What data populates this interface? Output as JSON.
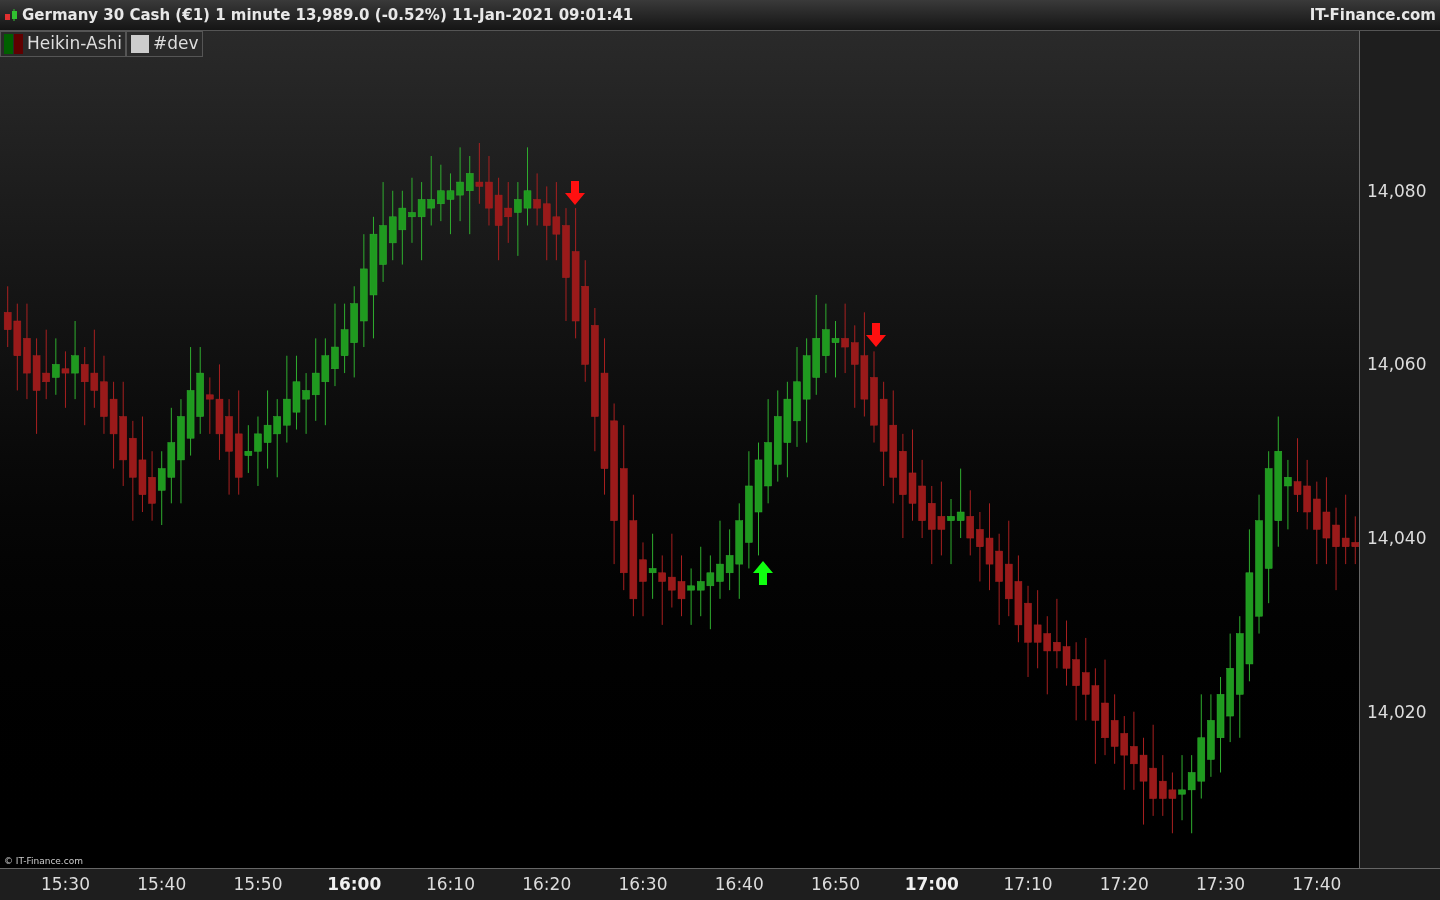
{
  "title_bar": {
    "title": "Germany 30 Cash (€1) 1 minute 13,989.0 (-0.52%) 11-Jan-2021 09:01:41",
    "brand": "IT-Finance.com"
  },
  "legend": [
    {
      "label": "Heikin-Ashi",
      "kind": "candles"
    },
    {
      "label": "#dev",
      "kind": "plain"
    }
  ],
  "chart_data": {
    "type": "candlestick",
    "ylim": [
      14002,
      14098.4
    ],
    "x": [
      924,
      925,
      926,
      927,
      928,
      929,
      930,
      931,
      932,
      933,
      934,
      935,
      936,
      937,
      938,
      939,
      940,
      941,
      942,
      943,
      944,
      945,
      946,
      947,
      948,
      949,
      950,
      951,
      952,
      953,
      954,
      955,
      956,
      957,
      958,
      959,
      960,
      961,
      962,
      963,
      964,
      965,
      966,
      967,
      968,
      969,
      970,
      971,
      972,
      973,
      974,
      975,
      976,
      977,
      978,
      979,
      980,
      981,
      982,
      983,
      984,
      985,
      986,
      987,
      988,
      989,
      990,
      991,
      992,
      993,
      994,
      995,
      996,
      997,
      998,
      999,
      1000,
      1001,
      1002,
      1003,
      1004,
      1005,
      1006,
      1007,
      1008,
      1009,
      1010,
      1011,
      1012,
      1013,
      1014,
      1015,
      1016,
      1017,
      1018,
      1019,
      1020,
      1021,
      1022,
      1023,
      1024,
      1025,
      1026,
      1027,
      1028,
      1029,
      1030,
      1031,
      1032,
      1033,
      1034,
      1035,
      1036,
      1037,
      1038,
      1039,
      1040,
      1041,
      1042,
      1043,
      1044,
      1045,
      1046,
      1047,
      1048,
      1049,
      1050,
      1051,
      1052,
      1053,
      1054,
      1055,
      1056,
      1057,
      1058,
      1059,
      1060,
      1061,
      1062,
      1063,
      1064
    ],
    "xlim": [
      923.2,
      1072.8
    ],
    "yticks": [
      {
        "value": 14080,
        "label": "14,080"
      },
      {
        "value": 14060,
        "label": "14,060"
      },
      {
        "value": 14040,
        "label": "14,040"
      },
      {
        "value": 14020,
        "label": "14,020"
      }
    ],
    "xticks": [
      {
        "value": 930,
        "label": "15:30"
      },
      {
        "value": 940,
        "label": "15:40"
      },
      {
        "value": 950,
        "label": "15:50"
      },
      {
        "value": 960,
        "label": "16:00"
      },
      {
        "value": 970,
        "label": "16:10"
      },
      {
        "value": 980,
        "label": "16:20"
      },
      {
        "value": 990,
        "label": "16:30"
      },
      {
        "value": 1000,
        "label": "16:40"
      },
      {
        "value": 1010,
        "label": "16:50"
      },
      {
        "value": 1020,
        "label": "17:00"
      },
      {
        "value": 1030,
        "label": "17:10"
      },
      {
        "value": 1040,
        "label": "17:20"
      },
      {
        "value": 1050,
        "label": "17:30"
      },
      {
        "value": 1060,
        "label": "17:40"
      }
    ],
    "ohlc": [
      [
        14066,
        14069,
        14062,
        14064
      ],
      [
        14065,
        14067,
        14057,
        14061
      ],
      [
        14063,
        14067,
        14056,
        14059
      ],
      [
        14061,
        14063,
        14052,
        14057
      ],
      [
        14059,
        14064,
        14056,
        14058
      ],
      [
        14058.5,
        14063,
        14056.5,
        14060
      ],
      [
        14059.5,
        14061.5,
        14055,
        14059
      ],
      [
        14059,
        14065,
        14056,
        14061
      ],
      [
        14060,
        14062,
        14053,
        14058
      ],
      [
        14059,
        14064,
        14055,
        14057
      ],
      [
        14058,
        14061,
        14052,
        14054
      ],
      [
        14056,
        14058,
        14048,
        14052
      ],
      [
        14054,
        14058,
        14046,
        14049
      ],
      [
        14051.5,
        14053.5,
        14042,
        14047
      ],
      [
        14049,
        14054,
        14043,
        14045
      ],
      [
        14047,
        14050,
        14042,
        14044
      ],
      [
        14045.5,
        14050,
        14041.5,
        14048
      ],
      [
        14047,
        14055,
        14044,
        14051
      ],
      [
        14049,
        14056,
        14044,
        14054
      ],
      [
        14051.5,
        14062,
        14049.5,
        14057
      ],
      [
        14054,
        14062,
        14052,
        14059
      ],
      [
        14056.5,
        14058.5,
        14052,
        14056
      ],
      [
        14056,
        14060,
        14049,
        14052
      ],
      [
        14054,
        14056,
        14045,
        14050
      ],
      [
        14052,
        14057,
        14045,
        14047
      ],
      [
        14049.5,
        14053,
        14047.5,
        14050
      ],
      [
        14050,
        14054,
        14046,
        14052
      ],
      [
        14051,
        14057,
        14048,
        14053
      ],
      [
        14052,
        14056,
        14047,
        14054
      ],
      [
        14053,
        14061,
        14051,
        14056
      ],
      [
        14054.5,
        14061,
        14052.5,
        14058
      ],
      [
        14056,
        14059,
        14052,
        14057
      ],
      [
        14056.5,
        14063,
        14053.5,
        14059
      ],
      [
        14058,
        14063,
        14053,
        14061
      ],
      [
        14059.5,
        14067,
        14057.5,
        14062
      ],
      [
        14061,
        14067,
        14059,
        14064
      ],
      [
        14062.5,
        14069,
        14058.5,
        14067
      ],
      [
        14065,
        14075,
        14062,
        14071
      ],
      [
        14068,
        14077,
        14063,
        14075
      ],
      [
        14071.5,
        14081,
        14069.5,
        14076
      ],
      [
        14074,
        14080,
        14072,
        14077
      ],
      [
        14075.5,
        14080,
        14071.5,
        14078
      ],
      [
        14077,
        14081.5,
        14074,
        14077.5
      ],
      [
        14077,
        14081,
        14072,
        14079
      ],
      [
        14078,
        14084,
        14076,
        14079
      ],
      [
        14078.5,
        14083,
        14076.5,
        14080
      ],
      [
        14079,
        14082,
        14075,
        14080
      ],
      [
        14079.5,
        14085,
        14076.5,
        14081
      ],
      [
        14080,
        14084,
        14075,
        14082
      ],
      [
        14081,
        14085.5,
        14078.5,
        14080.5
      ],
      [
        14081,
        14084,
        14076,
        14078
      ],
      [
        14079.5,
        14081.5,
        14072,
        14076
      ],
      [
        14078,
        14081,
        14074,
        14077
      ],
      [
        14077.5,
        14081,
        14072.5,
        14079
      ],
      [
        14078,
        14085,
        14076,
        14080
      ],
      [
        14079,
        14082,
        14076,
        14078
      ],
      [
        14078.5,
        14080.5,
        14072,
        14076
      ],
      [
        14077,
        14081,
        14072,
        14075
      ],
      [
        14076,
        14078,
        14065,
        14070
      ],
      [
        14073,
        14078,
        14063,
        14065
      ],
      [
        14069,
        14072,
        14058,
        14060
      ],
      [
        14064.5,
        14066.5,
        14050,
        14054
      ],
      [
        14059,
        14063,
        14045,
        14048
      ],
      [
        14053.5,
        14055.5,
        14037,
        14042
      ],
      [
        14048,
        14053,
        14034,
        14036
      ],
      [
        14042,
        14045,
        14031,
        14033
      ],
      [
        14037.5,
        14039.5,
        14031,
        14035
      ],
      [
        14036,
        14040.5,
        14033,
        14036.5
      ],
      [
        14036,
        14038,
        14030,
        14035
      ],
      [
        14035.5,
        14040.5,
        14032,
        14034
      ],
      [
        14035,
        14038,
        14031,
        14033
      ],
      [
        14034,
        14036.5,
        14030,
        14034.5
      ],
      [
        14034,
        14039,
        14031,
        14035
      ],
      [
        14034.5,
        14038,
        14029.5,
        14036
      ],
      [
        14035,
        14042,
        14033,
        14037
      ],
      [
        14036,
        14041,
        14034,
        14038
      ],
      [
        14037,
        14044,
        14033,
        14042
      ],
      [
        14039.5,
        14050,
        14036.5,
        14046
      ],
      [
        14043,
        14051,
        14038,
        14049
      ],
      [
        14046,
        14056,
        14044,
        14051
      ],
      [
        14048.5,
        14057,
        14046.5,
        14054
      ],
      [
        14051,
        14058,
        14047,
        14056
      ],
      [
        14053.5,
        14062,
        14050.5,
        14058
      ],
      [
        14056,
        14063,
        14051,
        14061
      ],
      [
        14058.5,
        14068,
        14056.5,
        14063
      ],
      [
        14061,
        14067,
        14059,
        14064
      ],
      [
        14062.5,
        14065,
        14058.5,
        14063
      ],
      [
        14063,
        14067,
        14059,
        14062
      ],
      [
        14062.5,
        14064.5,
        14055,
        14060
      ],
      [
        14061,
        14066,
        14054,
        14056
      ],
      [
        14058.5,
        14061.5,
        14051,
        14053
      ],
      [
        14056,
        14058,
        14046,
        14050
      ],
      [
        14053,
        14057,
        14044,
        14047
      ],
      [
        14050,
        14052,
        14040,
        14045
      ],
      [
        14047.5,
        14052.5,
        14042,
        14044
      ],
      [
        14046,
        14049,
        14040,
        14042
      ],
      [
        14044,
        14046,
        14037,
        14041
      ],
      [
        14042.5,
        14046.5,
        14038,
        14041
      ],
      [
        14042,
        14044.5,
        14037,
        14042.5
      ],
      [
        14042,
        14048,
        14040,
        14043
      ],
      [
        14042.5,
        14045.5,
        14038,
        14040
      ],
      [
        14041,
        14043,
        14035,
        14039
      ],
      [
        14040,
        14044,
        14034,
        14037
      ],
      [
        14038.5,
        14040.5,
        14030,
        14035
      ],
      [
        14037,
        14042,
        14031,
        14033
      ],
      [
        14035,
        14038,
        14028,
        14030
      ],
      [
        14032.5,
        14034.5,
        14024,
        14028
      ],
      [
        14030,
        14034,
        14025,
        14028
      ],
      [
        14029,
        14031,
        14022,
        14027
      ],
      [
        14028,
        14033,
        14025,
        14027
      ],
      [
        14027.5,
        14030.5,
        14023,
        14025
      ],
      [
        14026,
        14028,
        14019,
        14023
      ],
      [
        14024.5,
        14028.5,
        14019,
        14022
      ],
      [
        14023,
        14025,
        14014,
        14019
      ],
      [
        14021,
        14026,
        14015,
        14017
      ],
      [
        14019,
        14022,
        14014,
        14016
      ],
      [
        14017.5,
        14019.5,
        14011,
        14015
      ],
      [
        14016,
        14020,
        14011,
        14014
      ],
      [
        14015,
        14017,
        14007,
        14012
      ],
      [
        14013.5,
        14018.5,
        14008,
        14010
      ],
      [
        14012,
        14015,
        14008,
        14010
      ],
      [
        14011,
        14013,
        14006,
        14010
      ],
      [
        14010.5,
        14015,
        14007.5,
        14011
      ],
      [
        14011,
        14015,
        14006,
        14013
      ],
      [
        14012,
        14022,
        14010,
        14017
      ],
      [
        14014.5,
        14022,
        14012.5,
        14019
      ],
      [
        14017,
        14024,
        14013,
        14022
      ],
      [
        14019.5,
        14029,
        14016.5,
        14025
      ],
      [
        14022,
        14031,
        14017,
        14029
      ],
      [
        14025.5,
        14041,
        14023.5,
        14036
      ],
      [
        14031,
        14045,
        14029,
        14042
      ],
      [
        14036.5,
        14050,
        14032.5,
        14048
      ],
      [
        14042,
        14054,
        14039,
        14050
      ],
      [
        14046,
        14049,
        14041,
        14047
      ],
      [
        14046.5,
        14051.5,
        14043,
        14045
      ],
      [
        14046,
        14049,
        14041,
        14043
      ],
      [
        14044.5,
        14046.5,
        14037,
        14041
      ],
      [
        14043,
        14047,
        14037,
        14040
      ],
      [
        14041.5,
        14043.5,
        14034,
        14039
      ],
      [
        14040,
        14045,
        14037,
        14039
      ],
      [
        14039.5,
        14042.5,
        14037,
        14039
      ]
    ]
  },
  "signals": [
    {
      "kind": "sell"
    },
    {
      "kind": "buy"
    },
    {
      "kind": "sell"
    }
  ],
  "x_axis_bold": [
    false,
    false,
    false,
    true,
    false,
    false,
    false,
    false,
    false,
    true,
    false,
    false,
    false,
    false
  ],
  "copyright": "© IT-Finance.com"
}
